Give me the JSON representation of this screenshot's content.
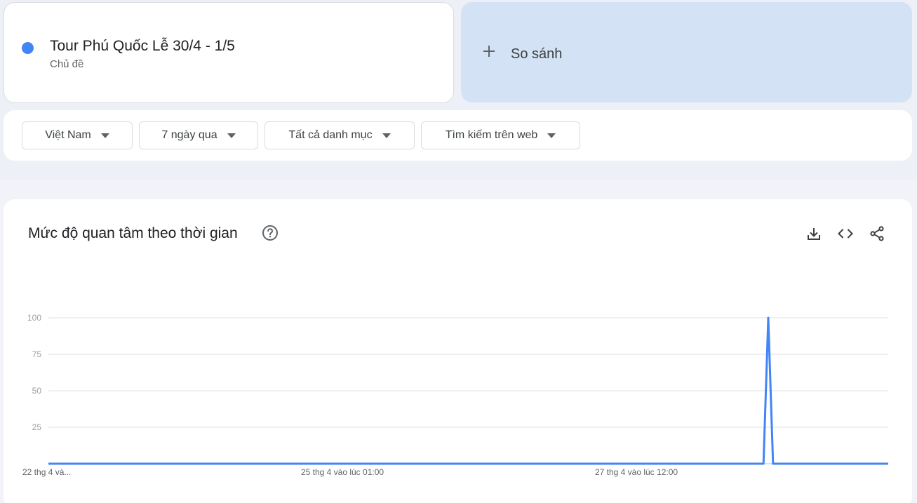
{
  "term": {
    "title": "Tour Phú Quốc Lễ 30/4 - 1/5",
    "subtitle": "Chủ đề",
    "color": "#4285f4"
  },
  "compare": {
    "label": "So sánh",
    "icon": "plus-icon"
  },
  "filters": [
    {
      "label": "Việt Nam"
    },
    {
      "label": "7 ngày qua"
    },
    {
      "label": "Tất cả danh mục"
    },
    {
      "label": "Tìm kiếm trên web"
    }
  ],
  "chart": {
    "title": "Mức độ quan tâm theo thời gian",
    "icons": [
      "help-icon",
      "download-icon",
      "embed-code-icon",
      "share-icon"
    ]
  },
  "chart_data": {
    "type": "line",
    "ylim": [
      0,
      100
    ],
    "y_ticks": [
      "100",
      "75",
      "50",
      "25"
    ],
    "x_labels": [
      "22 thg 4 và...",
      "25 thg 4 vào lúc 01:00",
      "27 thg 4 vào lúc 12:00"
    ],
    "series": [
      {
        "color": "#4285f4",
        "values": [
          0,
          0,
          0,
          0,
          0,
          0,
          0,
          0,
          0,
          0,
          0,
          0,
          0,
          0,
          0,
          0,
          0,
          0,
          0,
          0,
          0,
          0,
          0,
          0,
          0,
          0,
          0,
          0,
          0,
          0,
          0,
          0,
          0,
          0,
          0,
          0,
          0,
          0,
          0,
          0,
          0,
          0,
          0,
          0,
          0,
          0,
          0,
          0,
          0,
          0,
          0,
          0,
          0,
          0,
          0,
          0,
          0,
          0,
          0,
          0,
          0,
          0,
          0,
          0,
          0,
          0,
          0,
          0,
          0,
          0,
          0,
          0,
          0,
          0,
          0,
          0,
          0,
          0,
          0,
          0,
          0,
          0,
          0,
          0,
          0,
          0,
          0,
          0,
          0,
          0,
          0,
          0,
          0,
          0,
          0,
          0,
          0,
          0,
          0,
          0,
          0,
          0,
          0,
          0,
          0,
          0,
          0,
          0,
          0,
          0,
          0,
          0,
          0,
          0,
          0,
          0,
          0,
          0,
          0,
          0,
          0,
          0,
          0,
          0,
          0,
          0,
          0,
          0,
          0,
          0,
          0,
          0,
          0,
          0,
          0,
          0,
          0,
          0,
          0,
          0,
          0,
          0,
          0,
          0,
          0,
          0,
          0,
          0,
          0,
          0,
          100,
          0,
          0,
          0,
          0,
          0,
          0,
          0,
          0,
          0,
          0,
          0,
          0,
          0,
          0,
          0,
          0,
          0,
          0,
          0,
          0,
          0,
          0,
          0,
          0,
          0
        ]
      }
    ]
  }
}
